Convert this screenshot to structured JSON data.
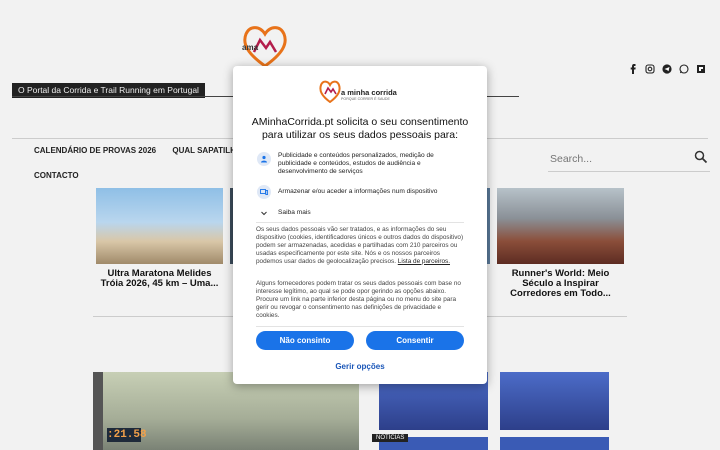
{
  "site": {
    "tagline": "O Portal da Corrida e Trail Running em Portugal",
    "nav": [
      "CALENDÁRIO DE PROVAS 2026",
      "QUAL SAPATILHA PARA TI"
    ],
    "nav_second_row": "CONTACTO",
    "search_placeholder": "Search..."
  },
  "cards": [
    {
      "title": "Ultra Maratona Melides Tróia 2026, 45 km – Uma..."
    },
    {
      "title": "Runner's World: Meio Século a Inspirar Corredores em Todo..."
    }
  ],
  "tags": {
    "news": "NOTÍCIAS"
  },
  "modal": {
    "logo_text": "a minha corrida",
    "logo_subtext": "PORQUE CORRER É SAUDE",
    "title": "AMinhaCorrida.pt solicita o seu consentimento para utilizar os seus dados pessoais para:",
    "purposes": [
      "Publicidade e conteúdos personalizados, medição de publicidade e conteúdos, estudos de audiência e desenvolvimento de serviços",
      "Armazenar e/ou aceder a informações num dispositivo",
      "Saiba mais"
    ],
    "paragraph1": "Os seus dados pessoais vão ser tratados, e as informações do seu dispositivo (cookies, identificadores únicos e outros dados do dispositivo) podem ser armazenadas, acedidas e partilhadas com 210 parceiros ou usadas especificamente por este site. Nós e os nossos parceiros podemos usar dados de geolocalização precisos.",
    "partners_link": "Lista de parceiros.",
    "paragraph2": "Alguns fornecedores podem tratar os seus dados pessoais com base no interesse legítimo, ao qual se pode opor gerindo as opções abaixo. Procure um link na parte inferior desta página ou no menu do site para gerir ou revogar o consentimento nas definições de privacidade e cookies.",
    "decline_label": "Não consinto",
    "accept_label": "Consentir",
    "manage_label": "Gerir opções"
  },
  "colors": {
    "accent": "#1a73e8",
    "link": "#1a56b8"
  }
}
